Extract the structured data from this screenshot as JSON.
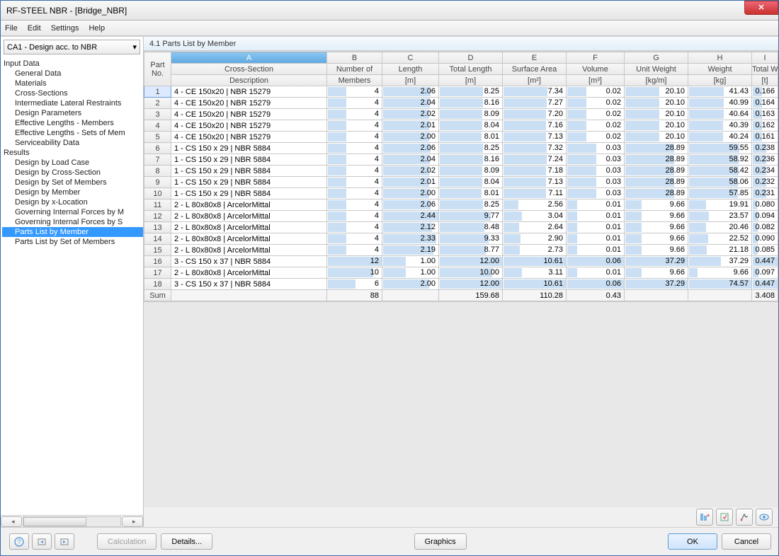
{
  "window_title": "RF-STEEL NBR - [Bridge_NBR]",
  "menu": {
    "file": "File",
    "edit": "Edit",
    "settings": "Settings",
    "help": "Help"
  },
  "case_dropdown": "CA1 - Design acc. to NBR",
  "pane_title": "4.1 Parts List by Member",
  "tree": {
    "input_data": "Input Data",
    "general_data": "General Data",
    "materials": "Materials",
    "cross_sections": "Cross-Sections",
    "intermediate_lateral_restraints": "Intermediate Lateral Restraints",
    "design_parameters": "Design Parameters",
    "effective_lengths_members": "Effective Lengths - Members",
    "effective_lengths_sets": "Effective Lengths - Sets of Mem",
    "serviceability_data": "Serviceability Data",
    "results": "Results",
    "design_by_load_case": "Design by Load Case",
    "design_by_cross_section": "Design by Cross-Section",
    "design_by_set_of_members": "Design by Set of Members",
    "design_by_member": "Design by Member",
    "design_by_x_location": "Design by x-Location",
    "gov_if_member": "Governing Internal Forces by M",
    "gov_if_set": "Governing Internal Forces by S",
    "parts_list_member": "Parts List by Member",
    "parts_list_set": "Parts List by Set of Members"
  },
  "columns": {
    "no_top": "Part",
    "no_bot": "No.",
    "a_letter": "A",
    "a_top": "Cross-Section",
    "a_bot": "Description",
    "b_letter": "B",
    "b_top": "Number of",
    "b_bot": "Members",
    "c_letter": "C",
    "c_top": "Length",
    "c_bot": "[m]",
    "d_letter": "D",
    "d_top": "Total Length",
    "d_bot": "[m]",
    "e_letter": "E",
    "e_top": "Surface Area",
    "e_bot": "[m²]",
    "f_letter": "F",
    "f_top": "Volume",
    "f_bot": "[m³]",
    "g_letter": "G",
    "g_top": "Unit Weight",
    "g_bot": "[kg/m]",
    "h_letter": "H",
    "h_top": "Weight",
    "h_bot": "[kg]",
    "i_letter": "I",
    "i_top": "Total Weight",
    "i_bot": "[t]"
  },
  "rows": [
    {
      "no": "1",
      "desc": "4 - CE 150x20 | NBR 15279",
      "members": "4",
      "length": "2.06",
      "total_len": "8.25",
      "surf": "7.34",
      "vol": "0.02",
      "uw": "20.10",
      "w": "41.43",
      "tw": "0.166"
    },
    {
      "no": "2",
      "desc": "4 - CE 150x20 | NBR 15279",
      "members": "4",
      "length": "2.04",
      "total_len": "8.16",
      "surf": "7.27",
      "vol": "0.02",
      "uw": "20.10",
      "w": "40.99",
      "tw": "0.164"
    },
    {
      "no": "3",
      "desc": "4 - CE 150x20 | NBR 15279",
      "members": "4",
      "length": "2.02",
      "total_len": "8.09",
      "surf": "7.20",
      "vol": "0.02",
      "uw": "20.10",
      "w": "40.64",
      "tw": "0.163"
    },
    {
      "no": "4",
      "desc": "4 - CE 150x20 | NBR 15279",
      "members": "4",
      "length": "2.01",
      "total_len": "8.04",
      "surf": "7.16",
      "vol": "0.02",
      "uw": "20.10",
      "w": "40.39",
      "tw": "0.162"
    },
    {
      "no": "5",
      "desc": "4 - CE 150x20 | NBR 15279",
      "members": "4",
      "length": "2.00",
      "total_len": "8.01",
      "surf": "7.13",
      "vol": "0.02",
      "uw": "20.10",
      "w": "40.24",
      "tw": "0.161"
    },
    {
      "no": "6",
      "desc": "1 - CS 150 x 29 | NBR 5884",
      "members": "4",
      "length": "2.06",
      "total_len": "8.25",
      "surf": "7.32",
      "vol": "0.03",
      "uw": "28.89",
      "w": "59.55",
      "tw": "0.238"
    },
    {
      "no": "7",
      "desc": "1 - CS 150 x 29 | NBR 5884",
      "members": "4",
      "length": "2.04",
      "total_len": "8.16",
      "surf": "7.24",
      "vol": "0.03",
      "uw": "28.89",
      "w": "58.92",
      "tw": "0.236"
    },
    {
      "no": "8",
      "desc": "1 - CS 150 x 29 | NBR 5884",
      "members": "4",
      "length": "2.02",
      "total_len": "8.09",
      "surf": "7.18",
      "vol": "0.03",
      "uw": "28.89",
      "w": "58.42",
      "tw": "0.234"
    },
    {
      "no": "9",
      "desc": "1 - CS 150 x 29 | NBR 5884",
      "members": "4",
      "length": "2.01",
      "total_len": "8.04",
      "surf": "7.13",
      "vol": "0.03",
      "uw": "28.89",
      "w": "58.06",
      "tw": "0.232"
    },
    {
      "no": "10",
      "desc": "1 - CS 150 x 29 | NBR 5884",
      "members": "4",
      "length": "2.00",
      "total_len": "8.01",
      "surf": "7.11",
      "vol": "0.03",
      "uw": "28.89",
      "w": "57.85",
      "tw": "0.231"
    },
    {
      "no": "11",
      "desc": "2 - L 80x80x8 | ArcelorMittal",
      "members": "4",
      "length": "2.06",
      "total_len": "8.25",
      "surf": "2.56",
      "vol": "0.01",
      "uw": "9.66",
      "w": "19.91",
      "tw": "0.080"
    },
    {
      "no": "12",
      "desc": "2 - L 80x80x8 | ArcelorMittal",
      "members": "4",
      "length": "2.44",
      "total_len": "9.77",
      "surf": "3.04",
      "vol": "0.01",
      "uw": "9.66",
      "w": "23.57",
      "tw": "0.094"
    },
    {
      "no": "13",
      "desc": "2 - L 80x80x8 | ArcelorMittal",
      "members": "4",
      "length": "2.12",
      "total_len": "8.48",
      "surf": "2.64",
      "vol": "0.01",
      "uw": "9.66",
      "w": "20.46",
      "tw": "0.082"
    },
    {
      "no": "14",
      "desc": "2 - L 80x80x8 | ArcelorMittal",
      "members": "4",
      "length": "2.33",
      "total_len": "9.33",
      "surf": "2.90",
      "vol": "0.01",
      "uw": "9.66",
      "w": "22.52",
      "tw": "0.090"
    },
    {
      "no": "15",
      "desc": "2 - L 80x80x8 | ArcelorMittal",
      "members": "4",
      "length": "2.19",
      "total_len": "8.77",
      "surf": "2.73",
      "vol": "0.01",
      "uw": "9.66",
      "w": "21.18",
      "tw": "0.085"
    },
    {
      "no": "16",
      "desc": "3 - CS 150 x 37 | NBR 5884",
      "members": "12",
      "length": "1.00",
      "total_len": "12.00",
      "surf": "10.61",
      "vol": "0.06",
      "uw": "37.29",
      "w": "37.29",
      "tw": "0.447"
    },
    {
      "no": "17",
      "desc": "2 - L 80x80x8 | ArcelorMittal",
      "members": "10",
      "length": "1.00",
      "total_len": "10.00",
      "surf": "3.11",
      "vol": "0.01",
      "uw": "9.66",
      "w": "9.66",
      "tw": "0.097"
    },
    {
      "no": "18",
      "desc": "3 - CS 150 x 37 | NBR 5884",
      "members": "6",
      "length": "2.00",
      "total_len": "12.00",
      "surf": "10.61",
      "vol": "0.06",
      "uw": "37.29",
      "w": "74.57",
      "tw": "0.447"
    }
  ],
  "sum": {
    "label": "Sum",
    "members": "88",
    "total_len": "159.68",
    "surf": "110.28",
    "vol": "0.43",
    "tw": "3.408"
  },
  "buttons": {
    "calculation": "Calculation",
    "details": "Details...",
    "graphics": "Graphics",
    "ok": "OK",
    "cancel": "Cancel"
  },
  "max": {
    "members": 12,
    "length": 2.44,
    "total_len": 12.0,
    "surf": 10.61,
    "vol": 0.06,
    "uw": 37.29,
    "w": 74.57,
    "tw": 0.447
  }
}
